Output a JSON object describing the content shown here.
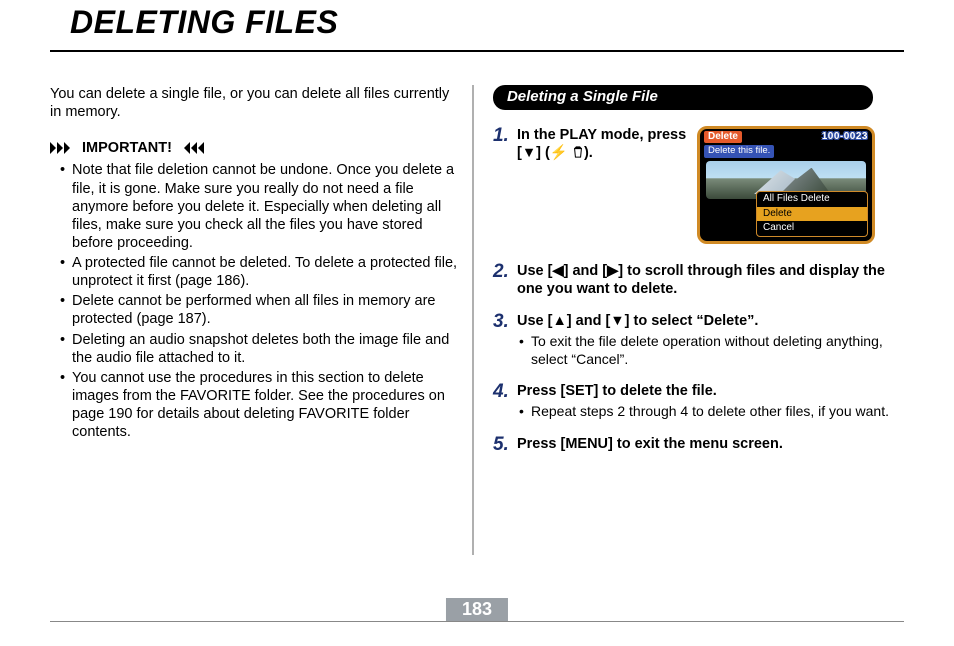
{
  "title": "DELETING FILES",
  "page_number": "183",
  "left": {
    "intro": "You can delete a single file, or you can delete all files currently in memory.",
    "important_label": "IMPORTANT!",
    "bullets": [
      "Note that file deletion cannot be undone. Once you delete a file, it is gone. Make sure you really do not need a file anymore before you delete it. Especially when deleting all files, make sure you check all the files you have stored before proceeding.",
      "A protected file cannot be deleted. To delete a protected file, unprotect it first (page 186).",
      "Delete cannot be performed when all files in memory are protected (page 187).",
      "Deleting an audio snapshot deletes both the image file and the audio file attached to it.",
      "You cannot use the procedures in this section to delete images from the FAVORITE folder. See the procedures on page 190 for details about deleting FAVORITE folder contents."
    ]
  },
  "right": {
    "section_title": "Deleting a Single File",
    "steps": {
      "s1": {
        "num": "1.",
        "text_a": "In the PLAY mode, press [",
        "text_b": "] (",
        "text_c": ")."
      },
      "s2": {
        "num": "2.",
        "text_a": "Use [",
        "text_b": " and [",
        "text_c": "] to scroll through files and display the one you want to delete."
      },
      "s3": {
        "num": "3.",
        "text_a": "Use [",
        "text_b": "] and [",
        "text_c": "] to select “Delete”.",
        "sub": "To exit the file delete operation without deleting anything, select “Cancel”."
      },
      "s4": {
        "num": "4.",
        "text": "Press [SET] to delete the file.",
        "sub": "Repeat steps 2 through 4 to delete other files, if you want."
      },
      "s5": {
        "num": "5.",
        "text": "Press [MENU] to exit the menu screen."
      }
    }
  },
  "screenshot": {
    "top_left": "Delete",
    "prompt": "Delete this file.",
    "file_id": "100-0023",
    "menu": [
      "All Files Delete",
      "Delete",
      "Cancel"
    ],
    "highlight_index": 1
  }
}
